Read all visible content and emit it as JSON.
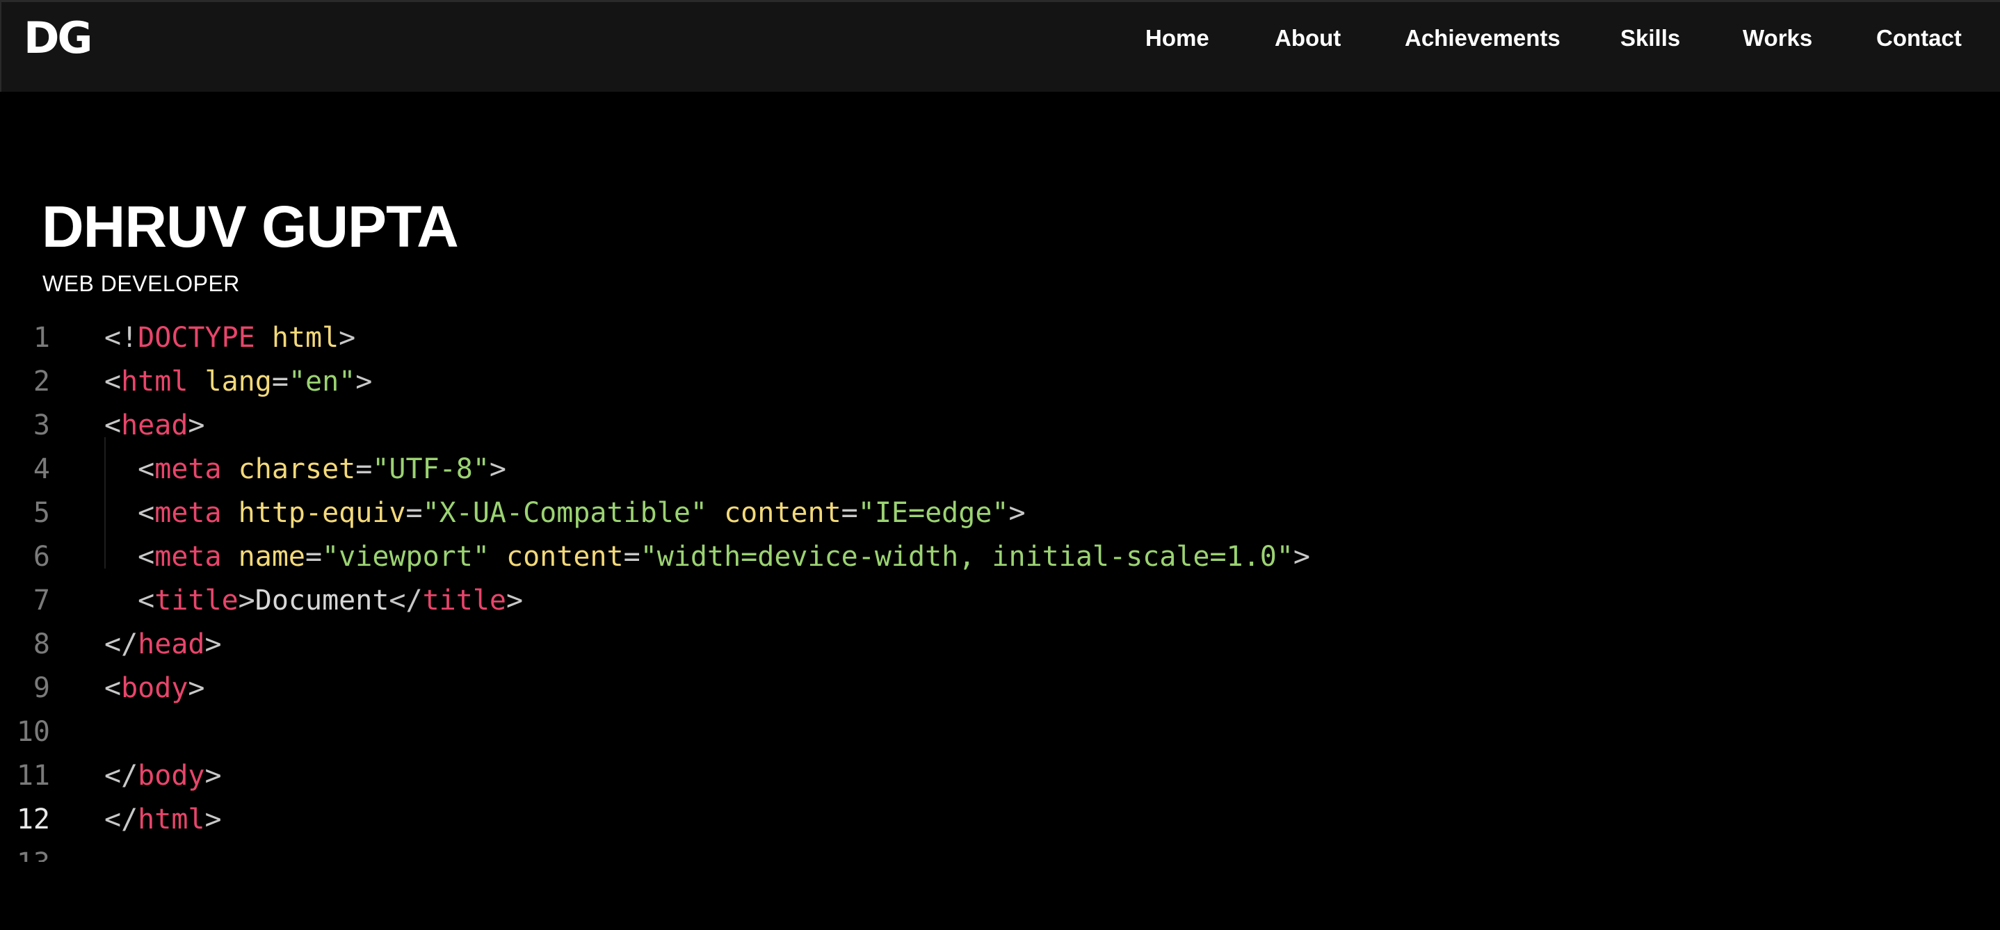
{
  "nav": {
    "logo": "DG",
    "links": [
      "Home",
      "About",
      "Achievements",
      "Skills",
      "Works",
      "Contact"
    ]
  },
  "hero": {
    "name": "DHRUV GUPTA",
    "role": "WEB DEVELOPER"
  },
  "code": {
    "active_line": 12,
    "lines": [
      [
        [
          "p",
          "<!"
        ],
        [
          "t",
          "DOCTYPE"
        ],
        [
          "p",
          " "
        ],
        [
          "a",
          "html"
        ],
        [
          "p",
          ">"
        ]
      ],
      [
        [
          "p",
          "<"
        ],
        [
          "t",
          "html"
        ],
        [
          "p",
          " "
        ],
        [
          "a",
          "lang"
        ],
        [
          "p",
          "="
        ],
        [
          "s",
          "\"en\""
        ],
        [
          "p",
          ">"
        ]
      ],
      [
        [
          "p",
          "<"
        ],
        [
          "t",
          "head"
        ],
        [
          "p",
          ">"
        ]
      ],
      [
        [
          "p",
          "  <"
        ],
        [
          "t",
          "meta"
        ],
        [
          "p",
          " "
        ],
        [
          "a",
          "charset"
        ],
        [
          "p",
          "="
        ],
        [
          "s",
          "\"UTF-8\""
        ],
        [
          "p",
          ">"
        ]
      ],
      [
        [
          "p",
          "  <"
        ],
        [
          "t",
          "meta"
        ],
        [
          "p",
          " "
        ],
        [
          "a",
          "http-equiv"
        ],
        [
          "p",
          "="
        ],
        [
          "s",
          "\"X-UA-Compatible\""
        ],
        [
          "p",
          " "
        ],
        [
          "a",
          "content"
        ],
        [
          "p",
          "="
        ],
        [
          "s",
          "\"IE=edge\""
        ],
        [
          "p",
          ">"
        ]
      ],
      [
        [
          "p",
          "  <"
        ],
        [
          "t",
          "meta"
        ],
        [
          "p",
          " "
        ],
        [
          "a",
          "name"
        ],
        [
          "p",
          "="
        ],
        [
          "s",
          "\"viewport\""
        ],
        [
          "p",
          " "
        ],
        [
          "a",
          "content"
        ],
        [
          "p",
          "="
        ],
        [
          "s",
          "\"width=device-width, initial-scale=1.0\""
        ],
        [
          "p",
          ">"
        ]
      ],
      [
        [
          "p",
          "  <"
        ],
        [
          "t",
          "title"
        ],
        [
          "p",
          ">"
        ],
        [
          "x",
          "Document"
        ],
        [
          "p",
          "</"
        ],
        [
          "t",
          "title"
        ],
        [
          "p",
          ">"
        ]
      ],
      [
        [
          "p",
          "</"
        ],
        [
          "t",
          "head"
        ],
        [
          "p",
          ">"
        ]
      ],
      [
        [
          "p",
          "<"
        ],
        [
          "t",
          "body"
        ],
        [
          "p",
          ">"
        ]
      ],
      [],
      [
        [
          "p",
          "</"
        ],
        [
          "t",
          "body"
        ],
        [
          "p",
          ">"
        ]
      ],
      [
        [
          "p",
          "</"
        ],
        [
          "t",
          "html"
        ],
        [
          "p",
          ">"
        ]
      ],
      []
    ]
  },
  "colors": {
    "background": "#000000",
    "navbar": "#141414",
    "tag": "#e8456b",
    "attribute": "#f3d97a",
    "string": "#9bd372",
    "punctuation": "#c8c8c8"
  }
}
